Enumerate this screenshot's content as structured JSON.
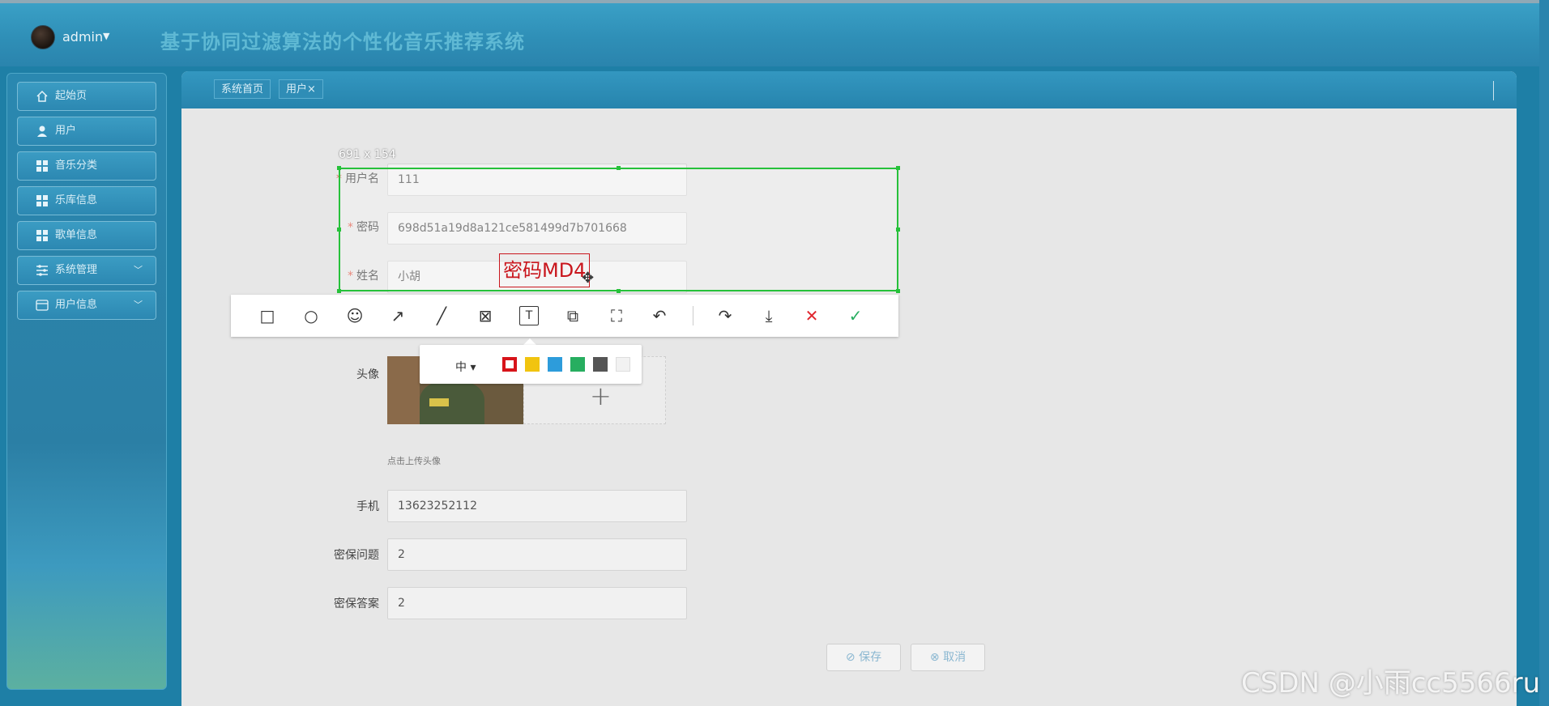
{
  "header": {
    "username": "admin",
    "app_title": "基于协同过滤算法的个性化音乐推荐系统"
  },
  "sidebar": {
    "items": [
      {
        "label": "起始页",
        "icon": "home-icon",
        "has_caret": false
      },
      {
        "label": "用户",
        "icon": "user-icon",
        "has_caret": false
      },
      {
        "label": "音乐分类",
        "icon": "grid-icon",
        "has_caret": false
      },
      {
        "label": "乐库信息",
        "icon": "grid-icon",
        "has_caret": false
      },
      {
        "label": "歌单信息",
        "icon": "grid-icon",
        "has_caret": false
      },
      {
        "label": "系统管理",
        "icon": "sliders-icon",
        "has_caret": true
      },
      {
        "label": "用户信息",
        "icon": "card-icon",
        "has_caret": true
      }
    ]
  },
  "tabs": [
    {
      "label": "系统首页"
    },
    {
      "label": "用户",
      "close": "×"
    }
  ],
  "form": {
    "username": {
      "label": "用户名",
      "value": "111"
    },
    "password": {
      "label": "密码",
      "value": "698d51a19d8a121ce581499d7b701668"
    },
    "name": {
      "label": "姓名",
      "value": "小胡"
    },
    "avatar": {
      "label": "头像",
      "hint": "点击上传头像"
    },
    "phone": {
      "label": "手机",
      "value": "13623252112"
    },
    "security_question": {
      "label": "密保问题",
      "value": "2"
    },
    "security_answer": {
      "label": "密保答案",
      "value": "2"
    },
    "save_label": "保存",
    "cancel_label": "取消"
  },
  "capture": {
    "size_text": "691 x 154",
    "annotation_text": "密码MD4",
    "size_option": "中",
    "colors": [
      "#d7141a",
      "#f1c40f",
      "#2d9cdb",
      "#27ae60",
      "#555555",
      "#f2f2f2"
    ]
  },
  "watermark": "CSDN @小雨cc5566ru"
}
